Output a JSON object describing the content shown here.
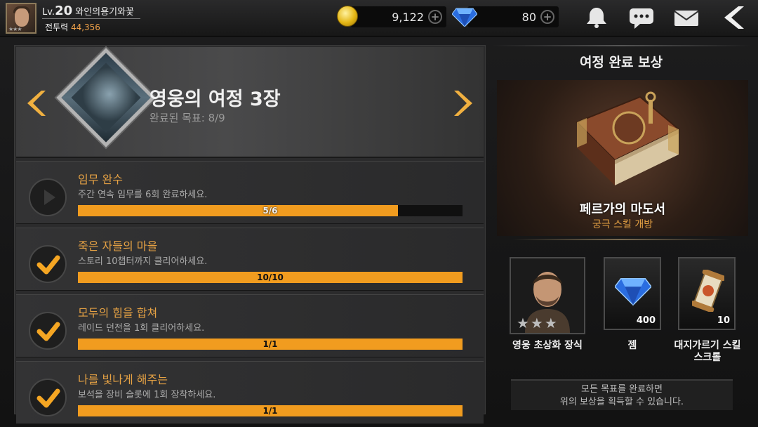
{
  "player": {
    "level_prefix": "Lv.",
    "level": "20",
    "name": "와인의용기와꽃",
    "power_label": "전투력",
    "power": "44,356"
  },
  "currency": {
    "gold": "9,122",
    "gems": "80"
  },
  "journey": {
    "title": "영웅의 여정 3장",
    "progress_text": "완료된 목표: 8/9"
  },
  "quests": [
    {
      "title": "임무 완수",
      "desc": "주간 연속 임무를 6회 완료하세요.",
      "progress": "5/6",
      "fraction": 0.833,
      "done": false
    },
    {
      "title": "죽은 자들의 마을",
      "desc": "스토리 10챕터까지 클리어하세요.",
      "progress": "10/10",
      "fraction": 1.0,
      "done": true
    },
    {
      "title": "모두의 힘을 합쳐",
      "desc": "레이드 던전을 1회 클리어하세요.",
      "progress": "1/1",
      "fraction": 1.0,
      "done": true
    },
    {
      "title": "나를 빛나게 해주는",
      "desc": "보석을 장비 슬롯에 1회 장착하세요.",
      "progress": "1/1",
      "fraction": 1.0,
      "done": true
    }
  ],
  "reward": {
    "heading": "여정 완료 보상",
    "main_name": "페르가의 마도서",
    "main_desc": "궁극 스킬 개방",
    "items": [
      {
        "label": "영웅 초상화 장식",
        "count": ""
      },
      {
        "label": "젬",
        "count": "400"
      },
      {
        "label": "대지가르기 스킬 스크롤",
        "count": "10"
      }
    ],
    "note_line1": "모든 목표를 완료하면",
    "note_line2": "위의 보상을 획득할 수 있습니다."
  },
  "colors": {
    "accent": "#f19c1f",
    "title_orange": "#e6a244"
  }
}
